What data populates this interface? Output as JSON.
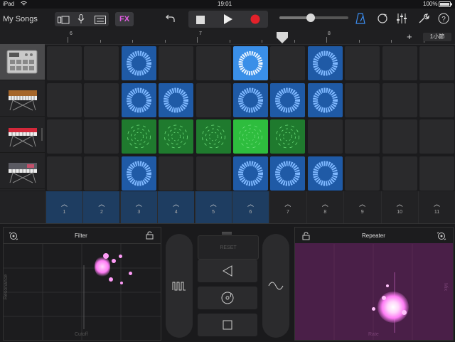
{
  "statusbar": {
    "device": "iPad",
    "wifi_icon": "wifi-icon",
    "time": "19:01",
    "battery": "100%"
  },
  "toolbar": {
    "back_label": "My Songs",
    "fx_label": "FX",
    "icons": [
      "browser-icon",
      "mic-icon",
      "mixer-icon",
      "undo-icon",
      "stop-icon",
      "play-icon",
      "record-icon",
      "metronome-icon",
      "loop-icon",
      "eq-icon",
      "wrench-icon",
      "help-icon"
    ]
  },
  "ruler": {
    "bars": [
      "6",
      "7",
      "8"
    ],
    "add_label": "+",
    "section_label": "1小節"
  },
  "instruments": [
    "drum-machine",
    "synth-keyboard",
    "red-keyboard",
    "workstation-keyboard"
  ],
  "grid": {
    "rows": [
      [
        "empty",
        "empty",
        "blue",
        "empty",
        "empty",
        "blue-bright",
        "empty",
        "blue",
        "empty",
        "empty",
        "empty"
      ],
      [
        "empty",
        "empty",
        "blue",
        "blue",
        "empty",
        "blue",
        "blue",
        "blue",
        "empty",
        "empty",
        "empty"
      ],
      [
        "empty",
        "empty",
        "green",
        "green",
        "green",
        "green-bright",
        "green",
        "empty",
        "empty",
        "empty",
        "empty"
      ],
      [
        "empty",
        "empty",
        "blue",
        "empty",
        "empty",
        "blue",
        "blue",
        "blue",
        "empty",
        "empty",
        "empty"
      ]
    ]
  },
  "triggers": {
    "numbers": [
      "1",
      "2",
      "3",
      "4",
      "5",
      "6",
      "7",
      "8",
      "9",
      "10",
      "11"
    ],
    "active_count": 6
  },
  "fx": {
    "filter_title": "Filter",
    "filter_xlabel": "Cutoff",
    "filter_ylabel": "Resonance",
    "repeater_title": "Repeater",
    "repeater_xlabel": "Rate",
    "repeater_ylabel": "Mix",
    "reset_label": "RESET",
    "colors": {
      "filter_bg": "#1c1c1e",
      "repeater_bg": "#4a1f48",
      "glow": "#ff7cf5"
    }
  }
}
